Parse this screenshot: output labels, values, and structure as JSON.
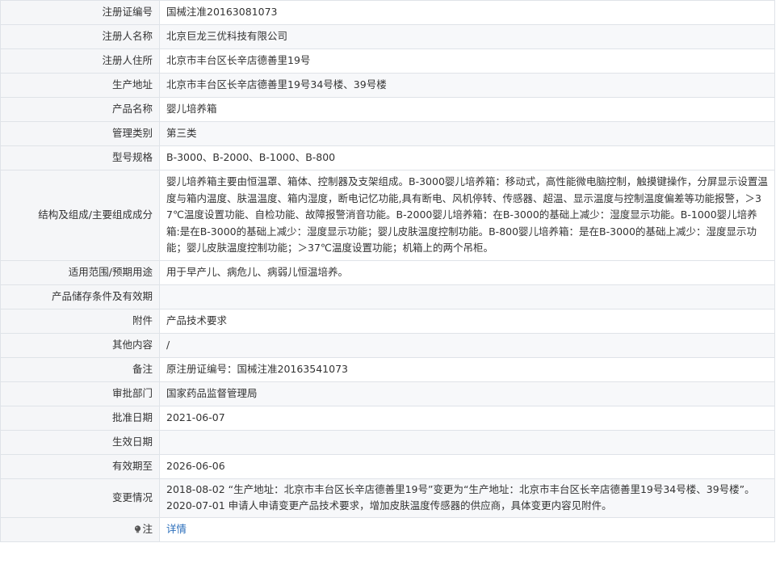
{
  "rows": [
    {
      "label": "注册证编号",
      "value": "国械注准20163081073"
    },
    {
      "label": "注册人名称",
      "value": "北京巨龙三优科技有限公司"
    },
    {
      "label": "注册人住所",
      "value": "北京市丰台区长辛店德善里19号"
    },
    {
      "label": "生产地址",
      "value": "北京市丰台区长辛店德善里19号34号楼、39号楼"
    },
    {
      "label": "产品名称",
      "value": "婴儿培养箱"
    },
    {
      "label": "管理类别",
      "value": "第三类"
    },
    {
      "label": "型号规格",
      "value": "B-3000、B-2000、B-1000、B-800"
    },
    {
      "label": "结构及组成/主要组成成分",
      "value": "婴儿培养箱主要由恒温罩、箱体、控制器及支架组成。B-3000婴儿培养箱：移动式，高性能微电脑控制，触摸键操作，分屏显示设置温度与箱内温度、肤温温度、箱内湿度，断电记忆功能,具有断电、风机停转、传感器、超温、显示温度与控制温度偏差等功能报警，＞37℃温度设置功能、自检功能、故障报警消音功能。B-2000婴儿培养箱：在B-3000的基础上减少：湿度显示功能。B-1000婴儿培养箱:是在B-3000的基础上减少：湿度显示功能；婴儿皮肤温度控制功能。B-800婴儿培养箱：是在B-3000的基础上减少：湿度显示功能；婴儿皮肤温度控制功能；＞37℃温度设置功能；机箱上的两个吊柜。"
    },
    {
      "label": "适用范围/预期用途",
      "value": "用于早产儿、病危儿、病弱儿恒温培养。"
    },
    {
      "label": "产品储存条件及有效期",
      "value": ""
    },
    {
      "label": "附件",
      "value": "产品技术要求"
    },
    {
      "label": "其他内容",
      "value": "/"
    },
    {
      "label": "备注",
      "value": "原注册证编号：国械注准20163541073"
    },
    {
      "label": "审批部门",
      "value": "国家药品监督管理局"
    },
    {
      "label": "批准日期",
      "value": "2021-06-07"
    },
    {
      "label": "生效日期",
      "value": ""
    },
    {
      "label": "有效期至",
      "value": "2026-06-06"
    }
  ],
  "change": {
    "label": "变更情况",
    "line1": "2018-08-02 “生产地址：北京市丰台区长辛店德善里19号”变更为“生产地址：北京市丰台区长辛店德善里19号34号楼、39号楼”。",
    "line2": "2020-07-01 申请人申请变更产品技术要求，增加皮肤温度传感器的供应商，具体变更内容见附件。"
  },
  "note": {
    "label": "注",
    "icon": "bulb-icon",
    "link_text": "详情"
  },
  "colors": {
    "label_bg": "#f5f6f8",
    "border": "#dfe3e8",
    "link": "#2a6ebb"
  }
}
